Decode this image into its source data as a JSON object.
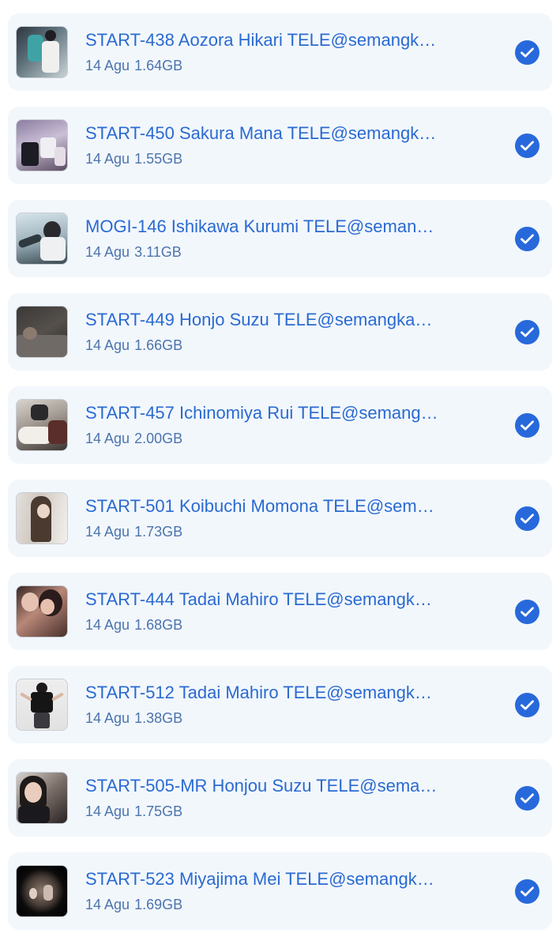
{
  "colors": {
    "card_background": "#f2f7fc",
    "title_text": "#2a6ad1",
    "meta_text": "#4c74ad",
    "check_background": "#2769db"
  },
  "items": [
    {
      "title": "START-438 Aozora Hikari TELE@semangk…",
      "date": "14 Agu",
      "size": "1.64GB",
      "thumb": "t1"
    },
    {
      "title": "START-450 Sakura Mana TELE@semangk…",
      "date": "14 Agu",
      "size": "1.55GB",
      "thumb": "t2"
    },
    {
      "title": "MOGI-146 Ishikawa Kurumi TELE@seman…",
      "date": "14 Agu",
      "size": "3.11GB",
      "thumb": "t3"
    },
    {
      "title": "START-449 Honjo Suzu TELE@semangka…",
      "date": "14 Agu",
      "size": "1.66GB",
      "thumb": "t4"
    },
    {
      "title": "START-457 Ichinomiya Rui TELE@semang…",
      "date": "14 Agu",
      "size": "2.00GB",
      "thumb": "t5"
    },
    {
      "title": "START-501 Koibuchi Momona TELE@sem…",
      "date": "14 Agu",
      "size": "1.73GB",
      "thumb": "t6"
    },
    {
      "title": "START-444 Tadai Mahiro TELE@semangk…",
      "date": "14 Agu",
      "size": "1.68GB",
      "thumb": "t7"
    },
    {
      "title": "START-512 Tadai Mahiro TELE@semangk…",
      "date": "14 Agu",
      "size": "1.38GB",
      "thumb": "t8"
    },
    {
      "title": "START-505-MR Honjou Suzu TELE@sema…",
      "date": "14 Agu",
      "size": "1.75GB",
      "thumb": "t9"
    },
    {
      "title": "START-523 Miyajima Mei TELE@semangk…",
      "date": "14 Agu",
      "size": "1.69GB",
      "thumb": "t10"
    }
  ],
  "icons": {
    "check": "checkmark-circle-icon"
  }
}
